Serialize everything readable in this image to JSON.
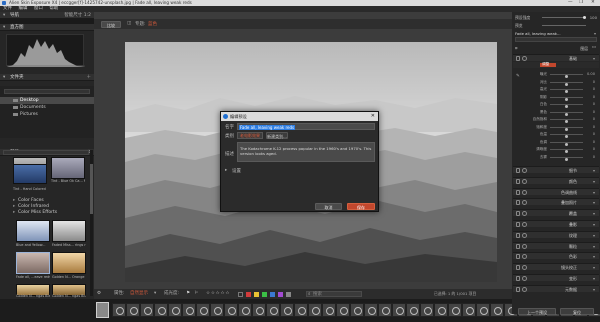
{
  "window": {
    "title": "Alien Skin Exposure X4 | eccgger[f]-1425742-unsplash.jpg | Fade all, leaving weak reds",
    "controls": [
      "—",
      "❐",
      "✕"
    ]
  },
  "menu": [
    "文件",
    "编辑",
    "窗口",
    "帮助"
  ],
  "left": {
    "nav_header": "导航",
    "nav_right": [
      "智能尺寸",
      "1:2"
    ],
    "histogram_header": "直方图",
    "folders_header": "文件夹",
    "folder_items": [
      "Desktop",
      "Documents",
      "Pictures"
    ],
    "presets_header": "预设",
    "preset_thumb_labels": [
      "ScreenRuen - II Wo...",
      "Tint - Blue Ok Ca... Magenta...",
      "Tint - Hand Colored"
    ],
    "preset_categories": [
      "Color Faces",
      "Color Infrared",
      "Color Miss Efforts"
    ],
    "preset_grid_labels": [
      "Blue and Yellow...",
      "Faded Miss... rings red",
      "Fade all, ...eave reds",
      "Golden N... Orange",
      "Golden N... ngas Bleck",
      "Golden N... ngas Blue"
    ]
  },
  "center": {
    "view_btn": "比较",
    "view_label": "专题:",
    "view_value": "蓝色",
    "bottom_label": "属性:",
    "bottom_select": "自然显示",
    "bottom_label2": "成光度:",
    "stars": "☆☆☆☆☆",
    "tag_colors": [
      "#d23b3b",
      "#e8c234",
      "#3bbf46",
      "#3b7ad2",
      "#a24bd2",
      "#888888"
    ],
    "search_placeholder": "搜索",
    "file_info": "已选择: 1 的 1/001 项目"
  },
  "dialog": {
    "title": "编辑预设",
    "name_label": "名字",
    "name_value": "Fade all, leaving weak reds",
    "group_label": "类别",
    "group_value": "老电影效果",
    "group_action": "新建类别...",
    "desc_label": "描述",
    "desc_value": "The Kodachrome K-12 process popular in the 1960's and 1970's. This version looks aged.",
    "settings_label": "设置",
    "cancel": "取消",
    "ok": "保存"
  },
  "right": {
    "top_row_label": "预设强度",
    "top_row_value": "100",
    "zoom_label": "预览",
    "preset_name": "Fade all, leaving weak...",
    "layers_label": "图层",
    "basic_header": "基础",
    "basic_tab": "调整",
    "sliders": [
      {
        "label": "曝光",
        "value": "0.00",
        "pos": 0.5
      },
      {
        "label": "对比",
        "value": "0",
        "pos": 0.5
      },
      {
        "label": "高光",
        "value": "0",
        "pos": 0.5
      },
      {
        "label": "阴影",
        "value": "0",
        "pos": 0.5
      },
      {
        "label": "白色",
        "value": "0",
        "pos": 0.5
      },
      {
        "label": "黑色",
        "value": "0",
        "pos": 0.5
      },
      {
        "label": "自然饱和",
        "value": "0",
        "pos": 0.5
      },
      {
        "label": "饱和度",
        "value": "0",
        "pos": 0.5
      },
      {
        "label": "色温",
        "value": "0",
        "pos": 0.5
      },
      {
        "label": "色调",
        "value": "0",
        "pos": 0.5
      },
      {
        "label": "清晰度",
        "value": "0",
        "pos": 0.5
      },
      {
        "label": "去雾",
        "value": "0",
        "pos": 0.5
      }
    ],
    "panels": [
      "细节",
      "颜色",
      "色调曲线",
      "叠加照片",
      "覆盖",
      "叠影",
      "纹理",
      "颗粒",
      "色彩",
      "镜头校正",
      "变形",
      "元数据"
    ],
    "btn_prev": "上一个预设",
    "btn_reset": "复位"
  }
}
